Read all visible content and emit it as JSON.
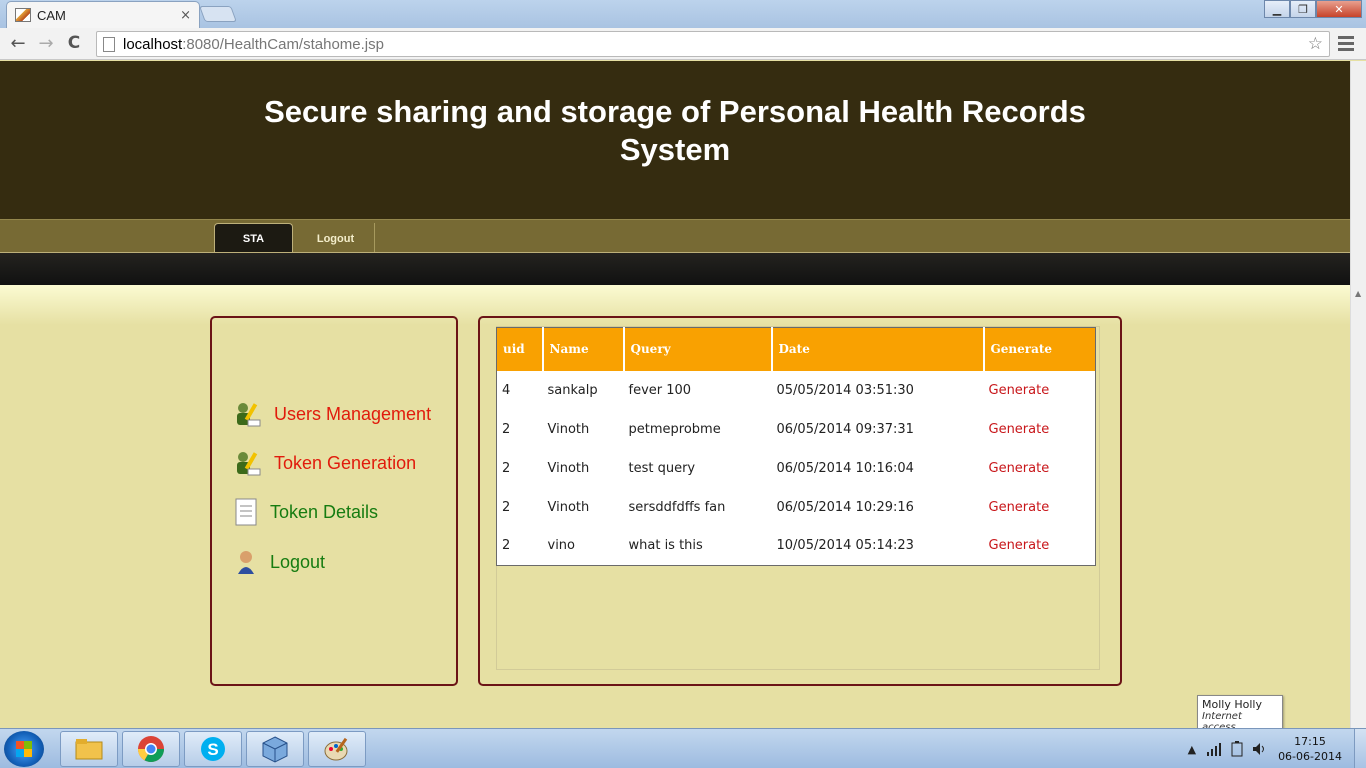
{
  "browser": {
    "tab_title": "CAM",
    "tab_close": "×",
    "url_host": "localhost",
    "url_path": ":8080/HealthCam/stahome.jsp",
    "back": "←",
    "forward": "→",
    "reload": "C",
    "star": "☆",
    "minimize": "▁",
    "maximize": "❐",
    "close": "✕"
  },
  "header": {
    "title_line1": "Secure sharing and storage of Personal Health Records",
    "title_line2": "System"
  },
  "nav": {
    "tabs": [
      "STA",
      "Logout"
    ]
  },
  "sidebar": {
    "items": [
      {
        "label": "Users Management",
        "icon": "users-edit-icon"
      },
      {
        "label": "Token Generation",
        "icon": "users-edit-icon"
      },
      {
        "label": "Token Details",
        "icon": "document-icon"
      },
      {
        "label": "Logout",
        "icon": "user-icon"
      }
    ]
  },
  "table": {
    "headers": [
      "uid",
      "Name",
      "Query",
      "Date",
      "Generate"
    ],
    "rows": [
      [
        "4",
        "sankalp",
        "fever 100",
        "05/05/2014 03:51:30",
        "Generate"
      ],
      [
        "2",
        "Vinoth",
        "petmeprobme",
        "06/05/2014 09:37:31",
        "Generate"
      ],
      [
        "2",
        "Vinoth",
        "test query",
        "06/05/2014 10:16:04",
        "Generate"
      ],
      [
        "2",
        "Vinoth",
        "sersddfdffs fan",
        "06/05/2014 10:29:16",
        "Generate"
      ],
      [
        "2",
        "vino",
        "what is this",
        "10/05/2014 05:14:23",
        "Generate"
      ]
    ]
  },
  "tooltip": {
    "title": "Molly Holly",
    "subtitle": "Internet access"
  },
  "taskbar": {
    "time": "17:15",
    "date": "06-06-2014",
    "apps": [
      "file-explorer-icon",
      "chrome-icon",
      "skype-icon",
      "virtualbox-icon",
      "paint-icon"
    ]
  },
  "colors": {
    "header_bg": "#352c10",
    "nav_bg": "#776a34",
    "page_bg": "#e6e0a3",
    "table_header": "#f9a101",
    "panel_border": "#6b1416",
    "link_red": "#e11b0c",
    "link_green": "#167c11"
  }
}
